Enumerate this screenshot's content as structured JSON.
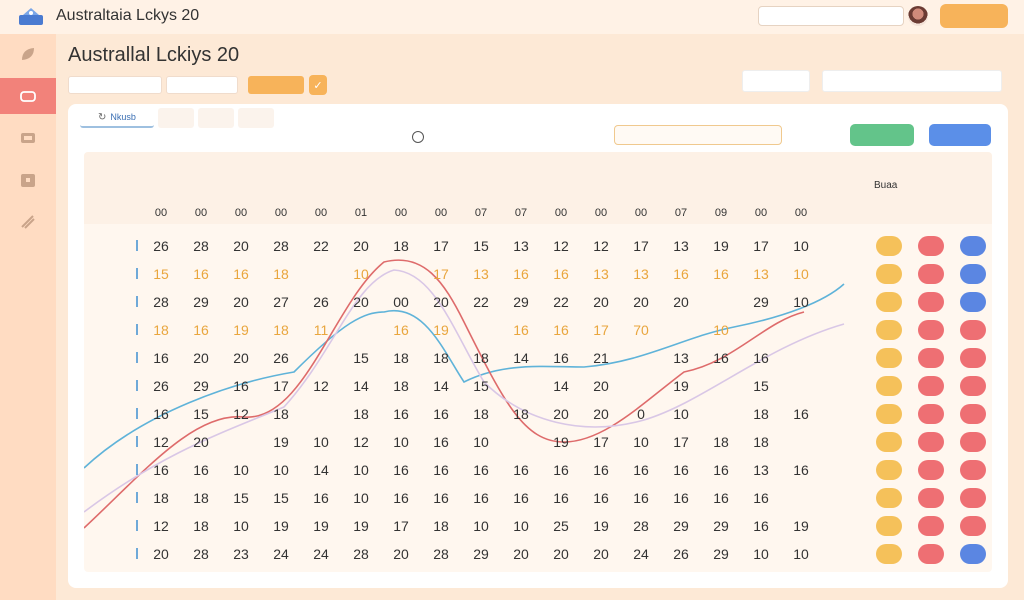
{
  "app": {
    "title": "Australtaia Lckys 20",
    "search_placeholder": "",
    "action_label": ""
  },
  "page": {
    "title": "Australlal Lckiys 20"
  },
  "filters": {
    "field1": "",
    "field2": "",
    "apply_label": "",
    "check_glyph": "✓"
  },
  "right_fields": [
    "",
    ""
  ],
  "tabs": [
    {
      "label": "Nkusb"
    },
    {
      "label": ""
    },
    {
      "label": ""
    },
    {
      "label": ""
    }
  ],
  "card_controls": {
    "radio_label": "",
    "accent_label": "",
    "input_placeholder": "",
    "green_label": "",
    "blue_label": ""
  },
  "column_headers": [
    "",
    "",
    "",
    "",
    "",
    "",
    "",
    "",
    "Buaa"
  ],
  "sub_headers": [
    "00",
    "00",
    "00",
    "00",
    "00",
    "01",
    "00",
    "00",
    "07",
    "07",
    "00",
    "00",
    "00",
    "07",
    "09",
    "00",
    "00"
  ],
  "rows": [
    {
      "vals": [
        26,
        28,
        20,
        28,
        22,
        20,
        18,
        17,
        15,
        13,
        12,
        12,
        17,
        13,
        19,
        17,
        10
      ],
      "color": "dark"
    },
    {
      "vals": [
        15,
        16,
        16,
        18,
        "",
        10,
        "",
        17,
        13,
        16,
        16,
        13,
        13,
        16,
        16,
        13,
        10
      ],
      "color": "orange"
    },
    {
      "vals": [
        28,
        29,
        20,
        27,
        26,
        20,
        "00",
        20,
        22,
        29,
        22,
        20,
        20,
        20,
        "",
        29,
        10
      ],
      "color": "dark"
    },
    {
      "vals": [
        18,
        16,
        19,
        18,
        11,
        "",
        16,
        19,
        "",
        16,
        16,
        17,
        70,
        "",
        10,
        "",
        ""
      ],
      "color": "orange"
    },
    {
      "vals": [
        16,
        20,
        20,
        26,
        "",
        15,
        18,
        18,
        18,
        14,
        16,
        21,
        "",
        13,
        16,
        16,
        ""
      ],
      "color": "dark"
    },
    {
      "vals": [
        26,
        29,
        16,
        17,
        12,
        14,
        18,
        14,
        15,
        "",
        14,
        20,
        "",
        19,
        "",
        15,
        ""
      ],
      "color": "dark"
    },
    {
      "vals": [
        16,
        15,
        12,
        18,
        "",
        18,
        16,
        16,
        18,
        18,
        20,
        20,
        0,
        10,
        "",
        18,
        16
      ],
      "color": "dark"
    },
    {
      "vals": [
        12,
        20,
        "",
        19,
        10,
        12,
        10,
        16,
        10,
        "",
        19,
        17,
        10,
        17,
        18,
        18,
        ""
      ],
      "color": "dark"
    },
    {
      "vals": [
        16,
        16,
        10,
        10,
        14,
        10,
        16,
        16,
        16,
        16,
        16,
        16,
        16,
        16,
        16,
        13,
        16
      ],
      "color": "dark"
    },
    {
      "vals": [
        18,
        18,
        15,
        15,
        16,
        10,
        16,
        16,
        16,
        16,
        16,
        16,
        16,
        16,
        16,
        16,
        ""
      ],
      "color": "dark"
    },
    {
      "vals": [
        12,
        18,
        10,
        19,
        19,
        19,
        17,
        18,
        10,
        10,
        25,
        19,
        28,
        29,
        29,
        16,
        19
      ],
      "color": "dark"
    },
    {
      "vals": [
        20,
        28,
        23,
        24,
        24,
        28,
        20,
        28,
        29,
        20,
        20,
        20,
        24,
        26,
        29,
        10,
        10
      ],
      "color": "dark"
    }
  ],
  "pill_columns": [
    [
      "y",
      "y",
      "y",
      "y",
      "y",
      "y",
      "y",
      "y",
      "y",
      "y",
      "y",
      "y"
    ],
    [
      "r",
      "r",
      "r",
      "r",
      "r",
      "r",
      "r",
      "r",
      "r",
      "r",
      "r",
      "r"
    ],
    [
      "b",
      "b",
      "b",
      "r",
      "r",
      "r",
      "r",
      "r",
      "r",
      "r",
      "r",
      "b"
    ]
  ],
  "colors": {
    "accent": "#f7b35a",
    "active_nav": "#f2827a",
    "blue_line": "#5fb3d9",
    "red_line": "#de6b6b"
  }
}
